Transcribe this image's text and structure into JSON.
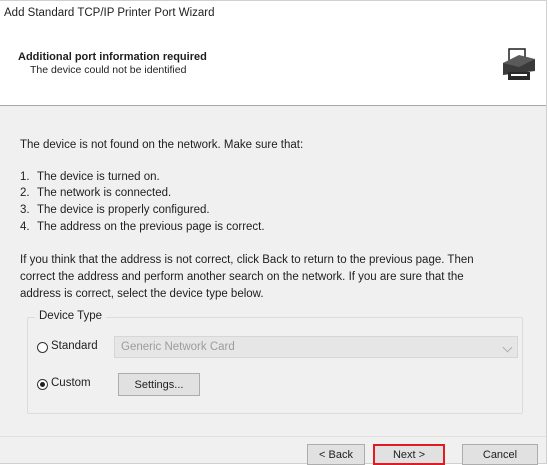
{
  "window": {
    "title": "Add Standard TCP/IP Printer Port Wizard"
  },
  "header": {
    "title": "Additional port information required",
    "subtitle": "The device could not be identified"
  },
  "content": {
    "intro": "The device is not found on the network. Make sure that:",
    "list": [
      {
        "num": "1.",
        "text": "The device is turned on."
      },
      {
        "num": "2.",
        "text": "The network is connected."
      },
      {
        "num": "3.",
        "text": "The device is properly configured."
      },
      {
        "num": "4.",
        "text": "The address on the previous page is correct."
      }
    ],
    "instructions": [
      "If you think that the address is not correct, click Back to return to the previous page. Then",
      "correct the address and perform another search on the network. If you are sure that the",
      "address is correct, select the device type below."
    ]
  },
  "device_type": {
    "group_label": "Device Type",
    "standard_label": "Standard",
    "standard_value": "Generic Network Card",
    "custom_label": "Custom",
    "selected": "custom",
    "settings_label": "Settings..."
  },
  "footer": {
    "back_label": "< Back",
    "next_label": "Next >",
    "cancel_label": "Cancel"
  },
  "colors": {
    "highlight": "#e01b24"
  }
}
